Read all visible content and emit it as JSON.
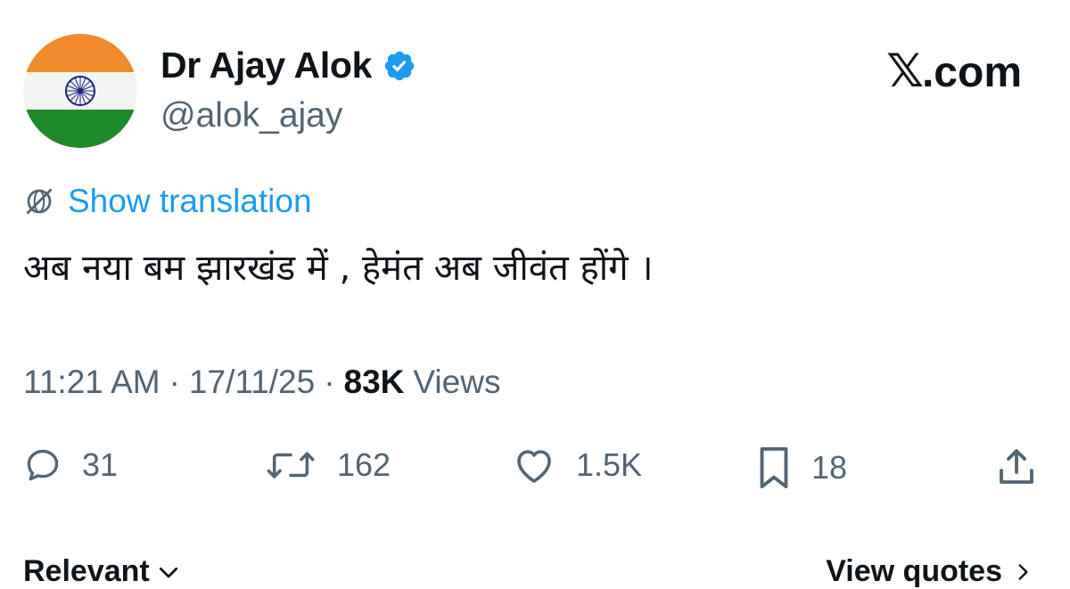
{
  "author": {
    "display_name": "Dr Ajay Alok",
    "handle": "@alok_ajay"
  },
  "brand": {
    "site": ".com",
    "x_glyph": "𝕏"
  },
  "tweet": {
    "translate_label": "Show translation",
    "text": "अब नया बम झारखंड में , हेमंत अब जीवंत होंगे ।"
  },
  "meta": {
    "time": "11:21 AM",
    "sep1": "·",
    "date": "17/11/25",
    "sep2": "·",
    "views_count": "83K",
    "views_label": "Views"
  },
  "actions": {
    "replies": "31",
    "reposts": "162",
    "likes": "1.5K",
    "bookmarks": "18"
  },
  "footer": {
    "sort_label": "Relevant",
    "quotes_label": "View quotes"
  },
  "colors": {
    "accent": "#1d9bf0",
    "muted": "#536471",
    "text": "#0f1419",
    "flag_saffron": "#ff9933",
    "flag_green": "#138808",
    "chakra": "#000080"
  },
  "icons": {
    "translate": "globe-slash-icon",
    "verified": "verified-badge-icon",
    "reply": "reply-icon",
    "repost": "repost-icon",
    "like": "heart-icon",
    "bookmark": "bookmark-icon",
    "share": "share-icon"
  }
}
